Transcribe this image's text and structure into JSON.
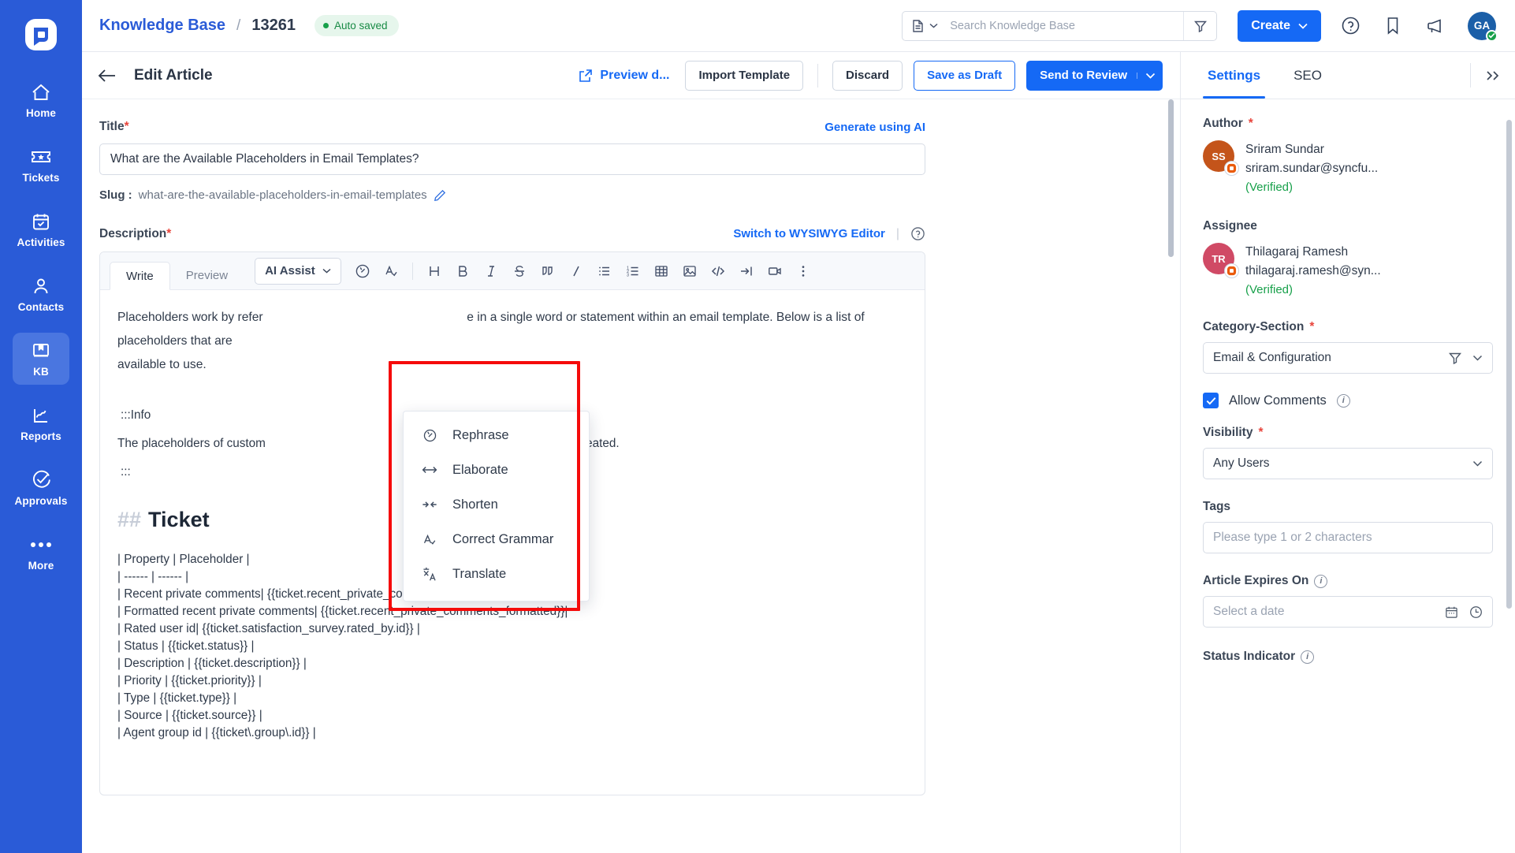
{
  "sidebar": {
    "logo_icon": "app-logo-icon",
    "items": [
      {
        "label": "Home",
        "icon": "home-icon"
      },
      {
        "label": "Tickets",
        "icon": "ticket-icon"
      },
      {
        "label": "Activities",
        "icon": "calendar-check-icon"
      },
      {
        "label": "Contacts",
        "icon": "person-icon"
      },
      {
        "label": "KB",
        "icon": "book-icon"
      },
      {
        "label": "Reports",
        "icon": "chart-line-icon"
      },
      {
        "label": "Approvals",
        "icon": "check-circle-icon"
      },
      {
        "label": "More",
        "icon": "ellipsis-icon"
      }
    ]
  },
  "topbar": {
    "breadcrumb_root": "Knowledge Base",
    "breadcrumb_separator": "/",
    "breadcrumb_id": "13261",
    "autosave_status": "Auto saved",
    "search_placeholder": "Search Knowledge Base",
    "search_value": "",
    "create_label": "Create",
    "icons": [
      "help-icon",
      "bookmark-icon",
      "announcement-icon"
    ],
    "avatar_initials": "GA"
  },
  "actionbar": {
    "back_icon": "back-arrow-icon",
    "title": "Edit Article",
    "preview_label": "Preview d...",
    "import_template_label": "Import Template",
    "discard_label": "Discard",
    "save_draft_label": "Save as Draft",
    "send_review_label": "Send to Review"
  },
  "form": {
    "title_label": "Title",
    "title_required": "*",
    "generate_ai_label": "Generate using AI",
    "title_value": "What are the Available Placeholders in Email Templates?",
    "slug_label": "Slug :",
    "slug_value": "what-are-the-available-placeholders-in-email-templates",
    "description_label": "Description",
    "description_required": "*",
    "switch_editor_label": "Switch to WYSIWYG Editor"
  },
  "editor": {
    "tabs": [
      {
        "label": "Write",
        "active": true
      },
      {
        "label": "Preview",
        "active": false
      }
    ],
    "ai_assist_label": "AI Assist",
    "toolbar_icons": [
      "history-icon",
      "grammar-icon",
      "heading-icon",
      "bold-icon",
      "italic-icon",
      "strikethrough-icon",
      "quote-icon",
      "code-inline-icon",
      "bullet-list-icon",
      "numbered-list-icon",
      "table-icon",
      "image-icon",
      "code-block-icon",
      "indent-icon",
      "video-icon",
      "more-icon"
    ],
    "ai_menu": [
      {
        "label": "Rephrase",
        "icon": "rephrase-icon"
      },
      {
        "label": "Elaborate",
        "icon": "elaborate-icon"
      },
      {
        "label": "Shorten",
        "icon": "shorten-icon"
      },
      {
        "label": "Correct Grammar",
        "icon": "correct-grammar-icon"
      },
      {
        "label": "Translate",
        "icon": "translate-icon"
      }
    ],
    "content": {
      "paragraph_1_a": "Placeholders work by refer",
      "paragraph_1_b": "e in a single word or statement within an email template. Below is a list of placeholders that are",
      "paragraph_1_c": "available to use.",
      "info_open": ":::Info",
      "info_text_a": "The placeholders of custom",
      "info_text_b": "n the field you have created.",
      "info_close": ":::",
      "heading_hash": "##",
      "heading_text": "Ticket",
      "table_lines": [
        "| Property | Placeholder |",
        "| ------ | ------ |",
        "| Recent private comments| {{ticket.recent_private_comments}}|",
        "| Formatted recent private comments| {{ticket.recent_private_comments_formatted}}|",
        "| Rated user id| {{ticket.satisfaction_survey.rated_by.id}} |",
        "| Status | {{ticket.status}} |",
        "| Description | {{ticket.description}} |",
        "| Priority | {{ticket.priority}} |",
        "| Type | {{ticket.type}} |",
        "| Source | {{ticket.source}} |",
        "| Agent group id | {{ticket\\.group\\.id}} |"
      ]
    }
  },
  "settings": {
    "tabs": [
      {
        "label": "Settings",
        "active": true
      },
      {
        "label": "SEO",
        "active": false
      }
    ],
    "expand_icon": "chevron-double-right-icon",
    "author_label": "Author",
    "author_required": "*",
    "author": {
      "initials": "SS",
      "avatar_color": "#c4541a",
      "name": "Sriram Sundar",
      "email": "sriram.sundar@syncfu...",
      "verified": "(Verified)"
    },
    "assignee_label": "Assignee",
    "assignee": {
      "initials": "TR",
      "avatar_color": "#d04a65",
      "name": "Thilagaraj Ramesh",
      "email": "thilagaraj.ramesh@syn...",
      "verified": "(Verified)"
    },
    "category_label": "Category-Section",
    "category_required": "*",
    "category_value": "Email & Configuration",
    "allow_comments_label": "Allow Comments",
    "allow_comments_checked": true,
    "visibility_label": "Visibility",
    "visibility_required": "*",
    "visibility_value": "Any Users",
    "tags_label": "Tags",
    "tags_placeholder": "Please type 1 or 2 characters",
    "expires_label": "Article Expires On",
    "expires_placeholder": "Select a date",
    "status_indicator_label": "Status Indicator"
  },
  "colors": {
    "brand_blue": "#1569f5",
    "rail_blue": "#2a5bd7",
    "success_green": "#17a04a",
    "highlight_red": "#f50b0b",
    "required_red": "#e8453c"
  }
}
